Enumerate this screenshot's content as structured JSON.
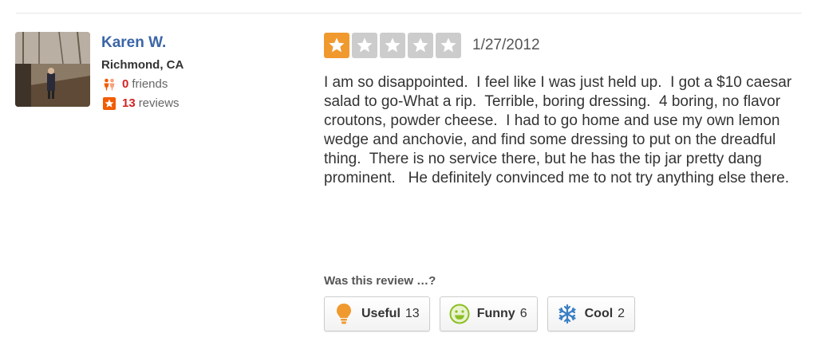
{
  "user": {
    "name": "Karen W.",
    "location": "Richmond, CA",
    "friends_count": "0",
    "friends_label": "friends",
    "reviews_count": "13",
    "reviews_label": "reviews"
  },
  "review": {
    "rating": 1,
    "rating_max": 5,
    "date": "1/27/2012",
    "text": "I am so disappointed.  I feel like I was just held up.  I got a $10 caesar salad to go-What a rip.  Terrible, boring dressing.  4 boring, no flavor croutons, powder cheese.  I had to go home and use my own lemon wedge and anchovie, and find some dressing to put on the dreadful thing.  There is no service there, but he has the tip jar pretty dang prominent.   He definitely convinced me to not try anything else there."
  },
  "votes": {
    "question": "Was this review …?",
    "useful": {
      "label": "Useful",
      "count": "13",
      "icon": "lightbulb-icon"
    },
    "funny": {
      "label": "Funny",
      "count": "6",
      "icon": "smiley-icon"
    },
    "cool": {
      "label": "Cool",
      "count": "2",
      "icon": "snowflake-icon"
    }
  },
  "colors": {
    "name_link": "#3b65a7",
    "star_on": "#f0992e",
    "star_off": "#cccccc",
    "count_red": "#d32323"
  }
}
